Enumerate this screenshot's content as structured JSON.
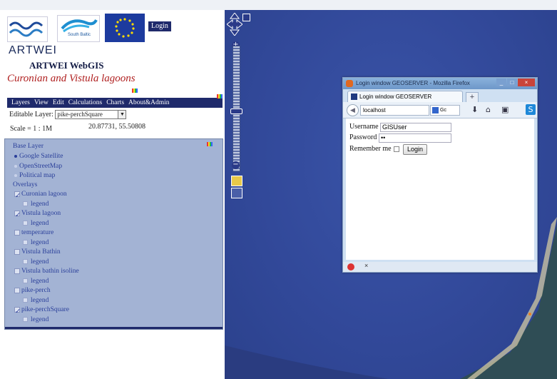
{
  "header": {
    "login_label": "Login",
    "artwei_label": "ARTWEI",
    "app_title": "ARTWEI WebGIS",
    "subtitle": "Curonian and Vistula lagoons",
    "south_baltic_label": "South Baltic"
  },
  "menu": {
    "items": [
      "Layers",
      "View",
      "Edit",
      "Calculations",
      "Charts",
      "About&Admin"
    ]
  },
  "editable_layer": {
    "label": "Editable Layer:",
    "value": "pike-perchSquare"
  },
  "scale": "Scale = 1 : 1M",
  "coordinates": "20.87731, 55.50808",
  "layers": {
    "base_title": "Base Layer",
    "base": [
      {
        "label": "Google Satellite",
        "selected": true
      },
      {
        "label": "OpenStreetMap",
        "selected": false
      },
      {
        "label": "Political map",
        "selected": false
      }
    ],
    "overlays_title": "Overlays",
    "overlays": [
      {
        "label": "Curonian lagoon",
        "checked": true
      },
      {
        "label": "Vistula lagoon",
        "checked": true
      },
      {
        "label": "temperature",
        "checked": false
      },
      {
        "label": "Vistula Bathin",
        "checked": false
      },
      {
        "label": "Vistula bathin isoline",
        "checked": false
      },
      {
        "label": "pike-perch",
        "checked": false
      },
      {
        "label": "pike-perchSquare",
        "checked": true
      }
    ],
    "legend_label": "legend"
  },
  "login_window": {
    "title": "Login window GEOSERVER - Mozilla Firefox",
    "tab_label": "Login window GEOSERVER",
    "new_tab_label": "+",
    "url": "localhost",
    "search_hint": "Gc",
    "username_label": "Username",
    "username_value": "GISUser",
    "password_label": "Password",
    "password_value": "••",
    "remember_label": "Remember me",
    "login_button": "Login",
    "close_tab_label": "×"
  }
}
